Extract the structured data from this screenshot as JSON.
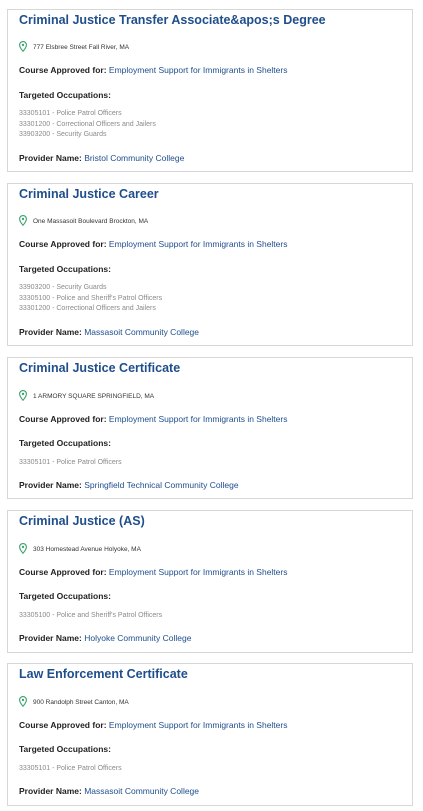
{
  "labels": {
    "course_approved": "Course Approved for:",
    "targeted_occupations": "Targeted Occupations:",
    "provider_name": "Provider Name:"
  },
  "colors": {
    "link": "#1f4e8c",
    "pin": "#3aa36c",
    "muted": "#8a8a8a",
    "border": "#d7d7d7"
  },
  "cards": [
    {
      "title": "Criminal Justice Transfer Associate&apos;s Degree",
      "address": "777 Elsbree Street Fall River, MA",
      "approved_for": "Employment Support for Immigrants in Shelters",
      "occupations": [
        "33305101 - Police Patrol Officers",
        "33301200 - Correctional Officers and Jailers",
        "33903200 - Security Guards"
      ],
      "provider": "Bristol Community College"
    },
    {
      "title": "Criminal Justice Career",
      "address": "One Massasoit Boulevard Brockton, MA",
      "approved_for": "Employment Support for Immigrants in Shelters",
      "occupations": [
        "33903200 - Security Guards",
        "33305100 - Police and Sheriff's Patrol Officers",
        "33301200 - Correctional Officers and Jailers"
      ],
      "provider": "Massasoit Community College"
    },
    {
      "title": "Criminal Justice Certificate",
      "address": "1 ARMORY SQUARE SPRINGFIELD, MA",
      "approved_for": "Employment Support for Immigrants in Shelters",
      "occupations": [
        "33305101 - Police Patrol Officers"
      ],
      "provider": "Springfield Technical Community College"
    },
    {
      "title": "Criminal Justice (AS)",
      "address": "303 Homestead Avenue Holyoke, MA",
      "approved_for": "Employment Support for Immigrants in Shelters",
      "occupations": [
        "33305100 - Police and Sheriff's Patrol Officers"
      ],
      "provider": "Holyoke Community College"
    },
    {
      "title": "Law Enforcement Certificate",
      "address": "900 Randolph Street Canton, MA",
      "approved_for": "Employment Support for Immigrants in Shelters",
      "occupations": [
        "33305101 - Police Patrol Officers"
      ],
      "provider": "Massasoit Community College"
    }
  ]
}
